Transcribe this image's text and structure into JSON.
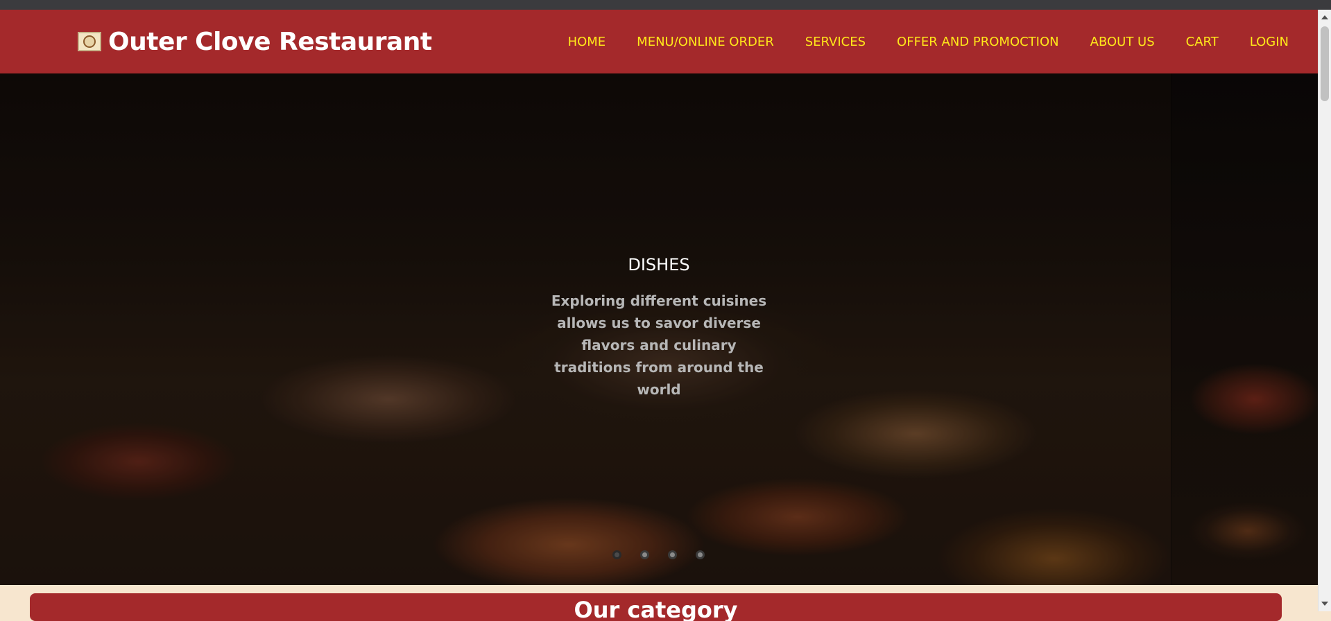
{
  "header": {
    "brand_name": "Outer Clove Restaurant",
    "logo_icon": "restaurant-seal-logo",
    "background_color": "#a4292b",
    "nav_color": "#ffe81a",
    "nav": [
      {
        "label": "HOME"
      },
      {
        "label": "MENU/ONLINE ORDER"
      },
      {
        "label": "SERVICES"
      },
      {
        "label": "OFFER AND PROMOCTION"
      },
      {
        "label": "ABOUT US"
      },
      {
        "label": "CART"
      },
      {
        "label": "LOGIN"
      }
    ]
  },
  "hero": {
    "title": "DISHES",
    "text": "Exploring different cuisines allows us to savor diverse flavors and culinary traditions from around the world",
    "slides": 4,
    "active_slide": 1
  },
  "category": {
    "title": "Our category"
  }
}
